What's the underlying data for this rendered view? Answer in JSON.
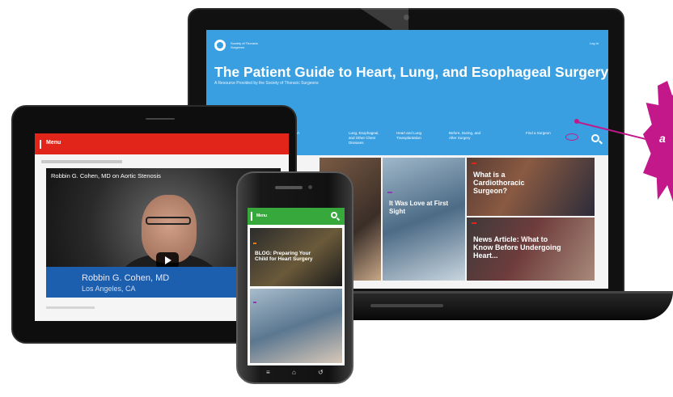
{
  "laptop": {
    "site": {
      "logo_text": "Society of Thoracic Surgeons",
      "login": "Log In",
      "title": "The Patient Guide to Heart, Lung, and Esophageal Surgery",
      "subtitle": "A Resource Provided by the Society of Thoracic Surgeons",
      "nav": [
        {
          "label": "Heart"
        },
        {
          "label": "Lung, Esophageal, and Other Chest Diseases"
        },
        {
          "label": "Heart and Lung Transplantation"
        },
        {
          "label": "Before, During, and After Surgery"
        },
        {
          "label": "Find a Surgeon"
        }
      ],
      "tiles": [
        {
          "tag": "",
          "title": ""
        },
        {
          "tag": "",
          "title": "It Was Love at First Sight"
        },
        {
          "tag": "",
          "title": "What is a Cardiothoracic Surgeon?"
        },
        {
          "tag": "",
          "title": "News Article: What to Know Before Undergoing Heart..."
        }
      ]
    }
  },
  "tablet": {
    "menu_label": "Menu",
    "video_title": "Robbin G. Cohen, MD on Aortic Stenosis",
    "lower_name": "Robbin G. Cohen, MD",
    "lower_location": "Los Angeles, CA"
  },
  "phone": {
    "menu_label": "Menu",
    "cards": [
      {
        "tag": "",
        "title": "BLOG: Preparing Your Child for Heart Surgery"
      },
      {
        "tag": "",
        "title": ""
      }
    ],
    "nav": {
      "back": "≡",
      "home": "⌂",
      "menu": "↺"
    }
  },
  "callout": {
    "text": "a"
  },
  "colors": {
    "site_blue": "#3a9fe0",
    "tablet_red": "#e1251b",
    "phone_green": "#37a83c",
    "callout_magenta": "#c2188a"
  }
}
